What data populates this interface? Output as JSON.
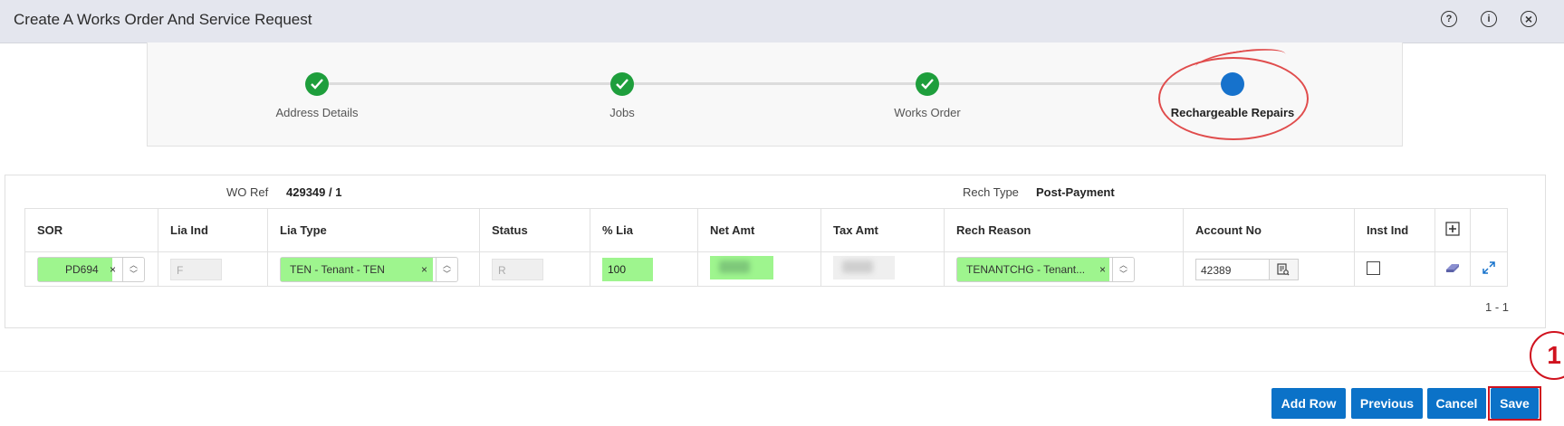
{
  "dialog": {
    "title": "Create A Works Order And Service Request",
    "icons": [
      "help-icon",
      "info-icon",
      "close-icon"
    ],
    "help_glyph": "?",
    "info_glyph": "i",
    "close_glyph": "×"
  },
  "wizard": {
    "steps": [
      {
        "label": "Address Details",
        "state": "complete"
      },
      {
        "label": "Jobs",
        "state": "complete"
      },
      {
        "label": "Works Order",
        "state": "complete"
      },
      {
        "label": "Rechargeable Repairs",
        "state": "current"
      }
    ]
  },
  "header_info": {
    "wo_ref_label": "WO Ref",
    "wo_ref_value": "429349 / 1",
    "rech_type_label": "Rech Type",
    "rech_type_value": "Post-Payment"
  },
  "grid": {
    "columns": [
      "SOR",
      "Lia Ind",
      "Lia Type",
      "Status",
      "% Lia",
      "Net Amt",
      "Tax Amt",
      "Rech Reason",
      "Account No",
      "Inst Ind"
    ],
    "add_row_icon": "plus-icon",
    "rows": [
      {
        "sor": "PD694",
        "lia_ind": "F",
        "lia_type": "TEN - Tenant - TEN",
        "status": "R",
        "pct_lia": "100",
        "rech_reason": "TENANTCHG - Tenant...",
        "account_no": "42389",
        "inst_ind_checked": false
      }
    ],
    "clear_glyph": "×",
    "spin_up": "︿",
    "spin_down": "﹀",
    "pagination": "1 - 1"
  },
  "buttons": {
    "add_row": "Add Row",
    "previous": "Previous",
    "cancel": "Cancel",
    "save": "Save"
  },
  "annotation": {
    "step_number": "1"
  },
  "colors": {
    "primary": "#0b72c8",
    "complete": "#1e9e3c",
    "current": "#1672cc",
    "highlight": "#9ef58e",
    "annotation_red": "#d0121e"
  }
}
